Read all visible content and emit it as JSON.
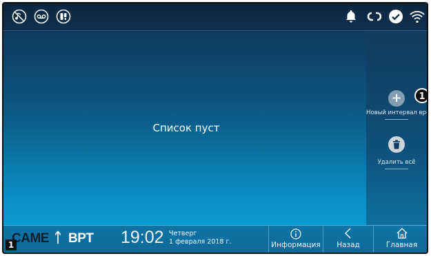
{
  "topbar": {
    "left_icons": [
      "mute-ring-icon",
      "answering-machine-icon",
      "do-not-disturb-icon"
    ],
    "status_icons": [
      "bell-icon",
      "sync-icon",
      "check-icon",
      "wifi-icon"
    ]
  },
  "main": {
    "empty_message": "Список пуст"
  },
  "sidebar": {
    "new_interval_label": "Новый интервал времени",
    "delete_all_label": "Удалить всё"
  },
  "bottombar": {
    "brand": "CAME",
    "brand_suffix": "BPT",
    "time": "19:02",
    "day": "Четверг",
    "date": "1 февраля 2018 г.",
    "nav": [
      {
        "label": "Информация",
        "icon": "info-icon"
      },
      {
        "label": "Назад",
        "icon": "back-icon"
      },
      {
        "label": "Главная",
        "icon": "home-icon"
      }
    ]
  },
  "annotations": {
    "callout_1": "1",
    "figure_badge": "1"
  }
}
